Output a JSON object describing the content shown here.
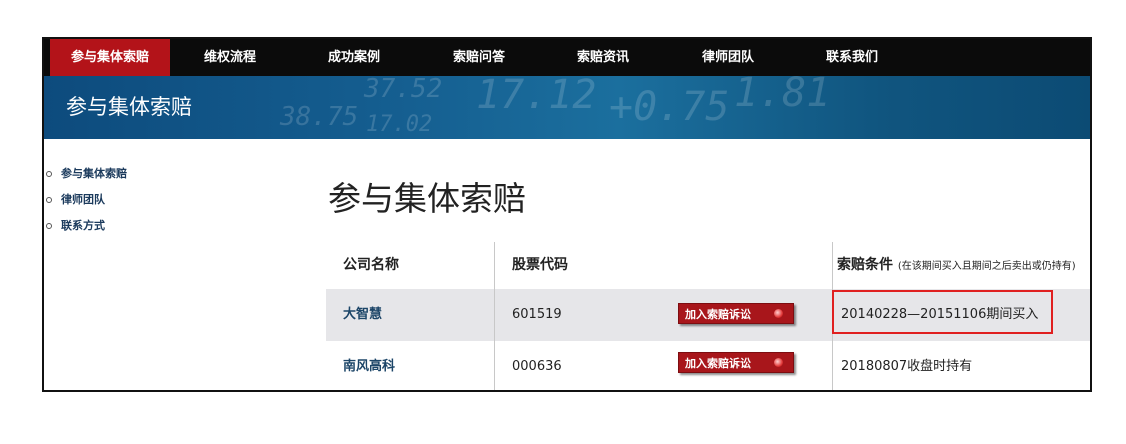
{
  "nav": {
    "items": [
      {
        "label": "参与集体索赔",
        "active": true
      },
      {
        "label": "维权流程",
        "active": false
      },
      {
        "label": "成功案例",
        "active": false
      },
      {
        "label": "索赔问答",
        "active": false
      },
      {
        "label": "索赔资讯",
        "active": false
      },
      {
        "label": "律师团队",
        "active": false
      },
      {
        "label": "联系我们",
        "active": false
      }
    ]
  },
  "banner": {
    "title": "参与集体索赔",
    "background_numbers": [
      "37.52",
      "17.12",
      "+0.75",
      "1.81",
      "17.02",
      "38.75"
    ]
  },
  "sidebar": {
    "items": [
      {
        "label": "参与集体索赔"
      },
      {
        "label": "律师团队"
      },
      {
        "label": "联系方式"
      }
    ]
  },
  "main": {
    "title": "参与集体索赔",
    "table": {
      "headers": {
        "company": "公司名称",
        "code": "股票代码",
        "condition": "索赔条件",
        "condition_note": "(在该期间买入且期间之后卖出或仍持有)"
      },
      "rows": [
        {
          "company": "大智慧",
          "code": "601519",
          "button": "加入索赔诉讼",
          "condition": "20140228—20151106期间买入",
          "highlighted": true
        },
        {
          "company": "南风高科",
          "code": "000636",
          "button": "加入索赔诉讼",
          "condition": "20180807收盘时持有",
          "highlighted": false
        }
      ]
    }
  },
  "colors": {
    "nav_bg": "#0b0b0b",
    "nav_active": "#b31319",
    "banner": "#155f91",
    "button": "#a8161b",
    "highlight": "#e02020",
    "link": "#1c4568"
  }
}
